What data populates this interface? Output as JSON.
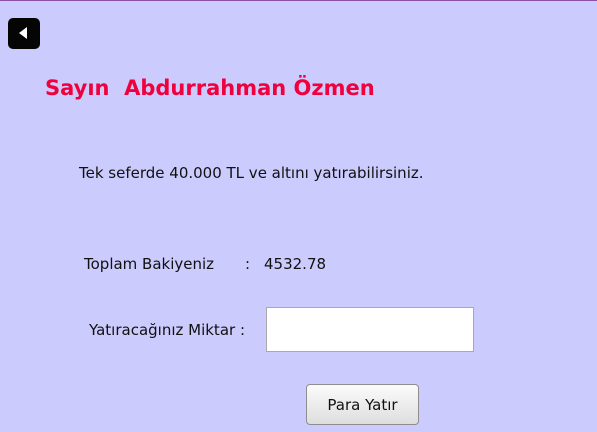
{
  "header": {
    "back_icon": "back-triangle-icon",
    "back_color": "#050505"
  },
  "greeting": {
    "text": "Sayın  Abdurrahman Özmen",
    "color": "#f0003c"
  },
  "info": {
    "limit_text": "Tek seferde 40.000 TL ve altını yatırabilirsiniz."
  },
  "balance": {
    "label": "Toplam Bakiyeniz",
    "separator": ":",
    "value": "4532.78"
  },
  "deposit": {
    "label": "Yatıracağınız Miktar :",
    "input_value": "",
    "button_label": "Para Yatır"
  },
  "theme": {
    "background": "#cccbfd"
  }
}
